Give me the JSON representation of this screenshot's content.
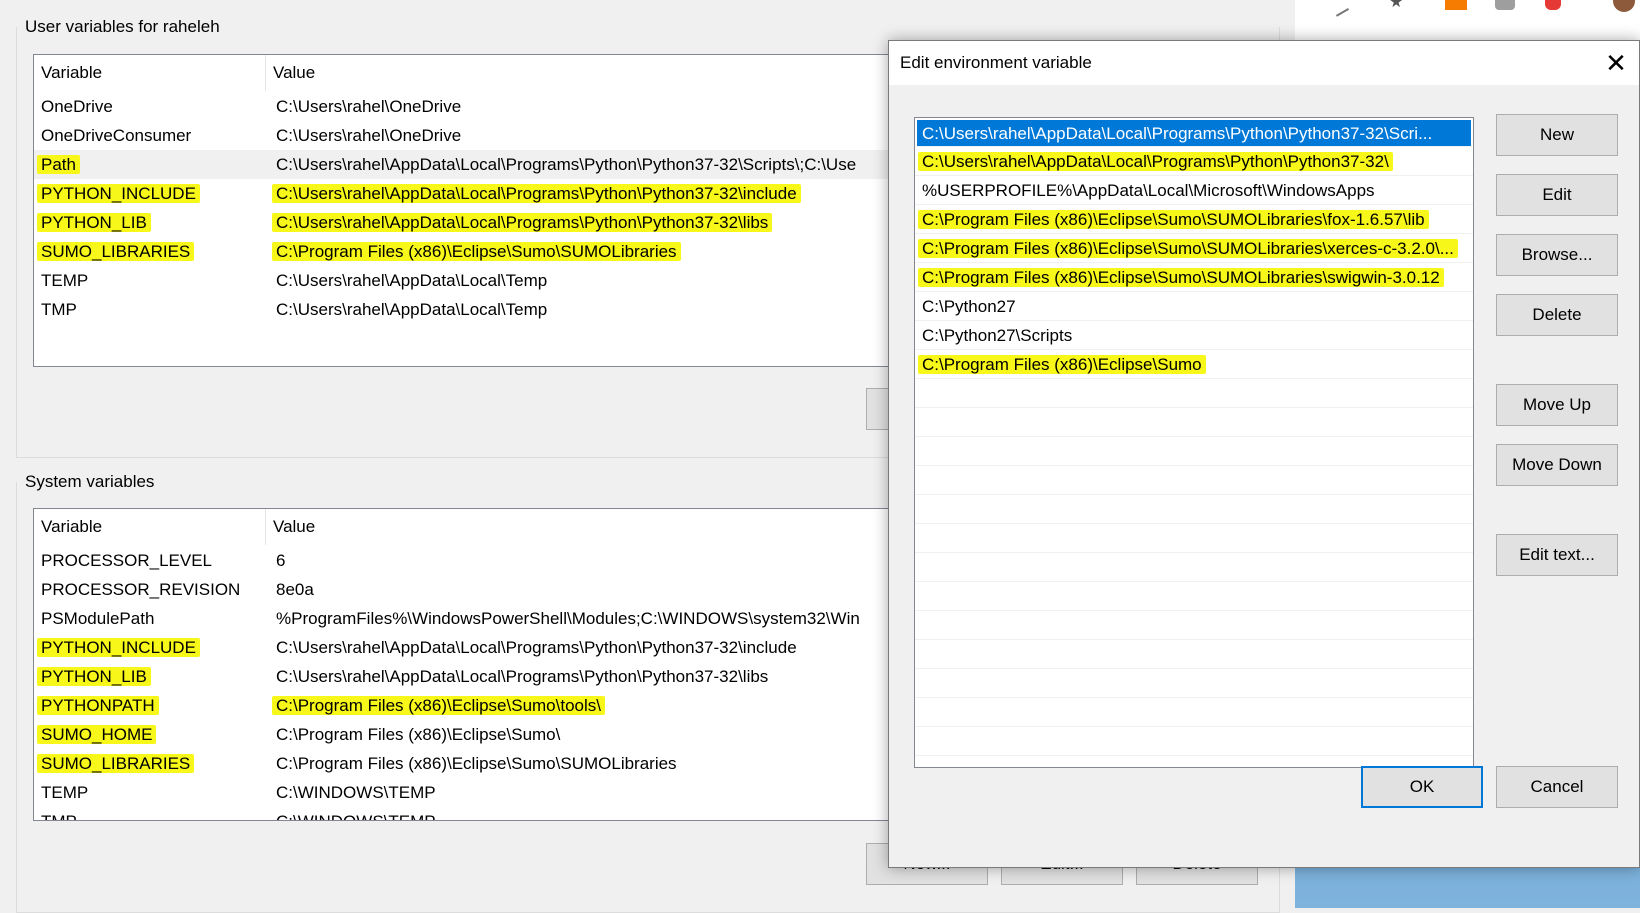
{
  "user_group": {
    "title": "User variables for raheleh",
    "header_variable": "Variable",
    "header_value": "Value",
    "rows": [
      {
        "variable": "OneDrive",
        "value": "C:\\Users\\rahel\\OneDrive"
      },
      {
        "variable": "OneDriveConsumer",
        "value": "C:\\Users\\rahel\\OneDrive"
      },
      {
        "variable": "Path",
        "value": "C:\\Users\\rahel\\AppData\\Local\\Programs\\Python\\Python37-32\\Scripts\\;C:\\Use"
      },
      {
        "variable": "PYTHON_INCLUDE",
        "value": "C:\\Users\\rahel\\AppData\\Local\\Programs\\Python\\Python37-32\\include"
      },
      {
        "variable": "PYTHON_LIB",
        "value": "C:\\Users\\rahel\\AppData\\Local\\Programs\\Python\\Python37-32\\libs"
      },
      {
        "variable": "SUMO_LIBRARIES",
        "value": "C:\\Program Files (x86)\\Eclipse\\Sumo\\SUMOLibraries"
      },
      {
        "variable": "TEMP",
        "value": "C:\\Users\\rahel\\AppData\\Local\\Temp"
      },
      {
        "variable": "TMP",
        "value": "C:\\Users\\rahel\\AppData\\Local\\Temp"
      }
    ]
  },
  "system_group": {
    "title": "System variables",
    "header_variable": "Variable",
    "header_value": "Value",
    "rows": [
      {
        "variable": "PROCESSOR_LEVEL",
        "value": "6"
      },
      {
        "variable": "PROCESSOR_REVISION",
        "value": "8e0a"
      },
      {
        "variable": "PSModulePath",
        "value": "%ProgramFiles%\\WindowsPowerShell\\Modules;C:\\WINDOWS\\system32\\Win"
      },
      {
        "variable": "PYTHON_INCLUDE",
        "value": "C:\\Users\\rahel\\AppData\\Local\\Programs\\Python\\Python37-32\\include"
      },
      {
        "variable": "PYTHON_LIB",
        "value": "C:\\Users\\rahel\\AppData\\Local\\Programs\\Python\\Python37-32\\libs"
      },
      {
        "variable": "PYTHONPATH",
        "value": "C:\\Program Files (x86)\\Eclipse\\Sumo\\tools\\"
      },
      {
        "variable": "SUMO_HOME",
        "value": "C:\\Program Files (x86)\\Eclipse\\Sumo\\"
      },
      {
        "variable": "SUMO_LIBRARIES",
        "value": "C:\\Program Files (x86)\\Eclipse\\Sumo\\SUMOLibraries"
      },
      {
        "variable": "TEMP",
        "value": "C:\\WINDOWS\\TEMP"
      },
      {
        "variable": "TMP",
        "value": "C:\\WINDOWS\\TEMP"
      }
    ],
    "buttons": {
      "new": "New...",
      "edit": "Edit...",
      "delete": "Delete"
    }
  },
  "dialog": {
    "title": "Edit environment variable",
    "close_glyph": "✕",
    "entries": [
      "C:\\Users\\rahel\\AppData\\Local\\Programs\\Python\\Python37-32\\Scri...",
      "C:\\Users\\rahel\\AppData\\Local\\Programs\\Python\\Python37-32\\",
      "%USERPROFILE%\\AppData\\Local\\Microsoft\\WindowsApps",
      "C:\\Program Files (x86)\\Eclipse\\Sumo\\SUMOLibraries\\fox-1.6.57\\lib",
      "C:\\Program Files (x86)\\Eclipse\\Sumo\\SUMOLibraries\\xerces-c-3.2.0\\...",
      "C:\\Program Files (x86)\\Eclipse\\Sumo\\SUMOLibraries\\swigwin-3.0.12",
      "C:\\Python27",
      "C:\\Python27\\Scripts",
      "C:\\Program Files (x86)\\Eclipse\\Sumo"
    ],
    "buttons": {
      "new": "New",
      "edit": "Edit",
      "browse": "Browse...",
      "delete": "Delete",
      "move_up": "Move Up",
      "move_down": "Move Down",
      "edit_text": "Edit text...",
      "ok": "OK",
      "cancel": "Cancel"
    }
  },
  "colors": {
    "highlight": "#f7f71a",
    "selection": "#0078d7",
    "window_bg": "#f0f0f0"
  }
}
